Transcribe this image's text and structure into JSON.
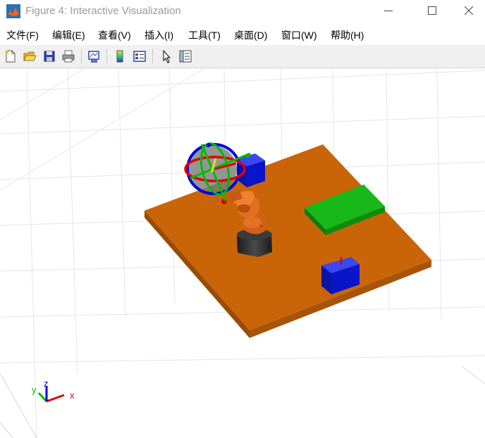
{
  "window": {
    "title": "Figure 4: Interactive Visualization",
    "controls": {
      "minimize": "minimize-icon",
      "maximize": "maximize-icon",
      "close": "close-icon"
    }
  },
  "menu": {
    "items": [
      "文件(F)",
      "编辑(E)",
      "查看(V)",
      "插入(I)",
      "工具(T)",
      "桌面(D)",
      "窗口(W)",
      "帮助(H)"
    ]
  },
  "toolbar": {
    "buttons": [
      {
        "icon": "new-figure-icon"
      },
      {
        "icon": "open-file-icon"
      },
      {
        "icon": "save-icon"
      },
      {
        "icon": "print-icon"
      },
      {
        "icon": "link-plot-icon"
      },
      {
        "icon": "insert-colorbar-icon"
      },
      {
        "icon": "insert-legend-icon"
      },
      {
        "icon": "edit-plot-icon"
      },
      {
        "icon": "property-inspector-icon"
      }
    ]
  },
  "scene": {
    "colors": {
      "table": "#c86400",
      "robot": "#e0701a",
      "base": "#2e2e2e",
      "box": "#0a14c8",
      "pad": "#0aa00a",
      "grid": "#e6e6e6",
      "axis_x": "#e00000",
      "axis_y": "#00bb00",
      "axis_z": "#0000dd"
    },
    "triad_labels": {
      "x": "x",
      "y": "y",
      "z": "z"
    }
  }
}
